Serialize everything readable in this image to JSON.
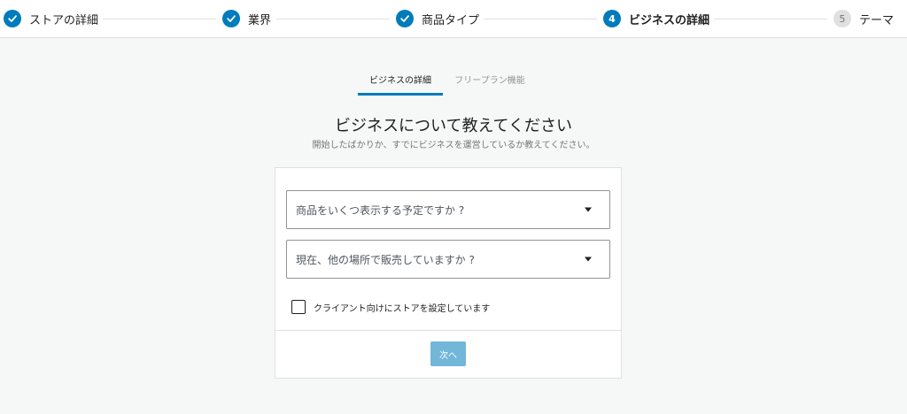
{
  "stepper": {
    "steps": [
      {
        "label": "ストアの詳細",
        "state": "completed"
      },
      {
        "label": "業界",
        "state": "completed"
      },
      {
        "label": "商品タイプ",
        "state": "completed"
      },
      {
        "label": "ビジネスの詳細",
        "state": "current",
        "number": "4"
      },
      {
        "label": "テーマ",
        "state": "upcoming",
        "number": "5"
      }
    ]
  },
  "tabs": [
    {
      "label": "ビジネスの詳細",
      "active": true
    },
    {
      "label": "フリープラン機能",
      "active": false
    }
  ],
  "main": {
    "title": "ビジネスについて教えてください",
    "subtitle": "開始したばかりか、すでにビジネスを運営しているか教えてください。"
  },
  "form": {
    "product_count_select": {
      "placeholder": "商品をいくつ表示する予定ですか ?"
    },
    "selling_elsewhere_select": {
      "placeholder": "現在、他の場所で販売していますか ?"
    },
    "client_checkbox": {
      "label": "クライアント向けにストアを設定しています",
      "checked": false
    },
    "next_button": {
      "label": "次へ",
      "enabled": false
    }
  },
  "colors": {
    "accent": "#007cba",
    "background": "#f6f7f7",
    "border": "#e0e0e0"
  },
  "icons": {
    "completed_step": "check-icon",
    "dropdown": "dropdown-arrow-icon"
  }
}
